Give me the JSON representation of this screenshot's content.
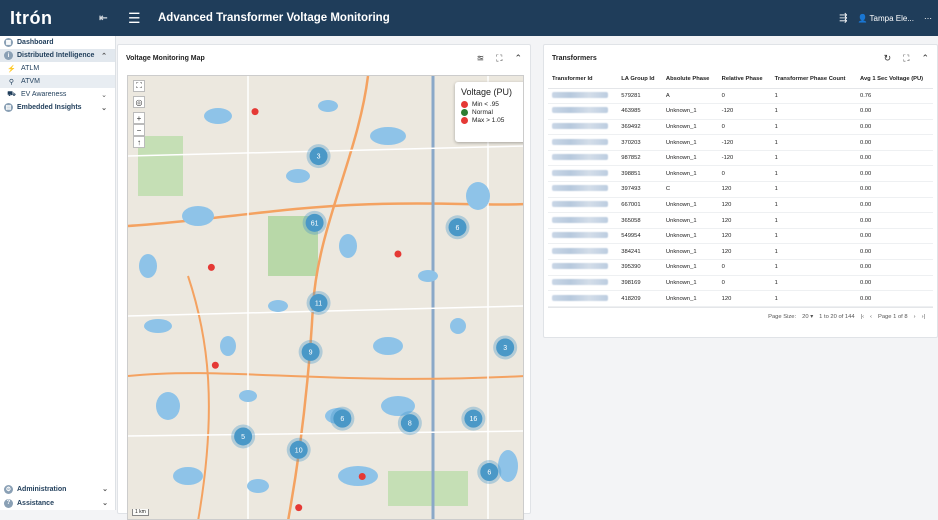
{
  "header": {
    "logo": "Itrón",
    "title": "Advanced Transformer Voltage Monitoring",
    "user": "Tampa Ele...",
    "collapse_icon": "sidebar-collapse-icon",
    "menu_icon": "hamburger-icon"
  },
  "sidebar": {
    "items": [
      {
        "label": "Dashboard",
        "icon": "dashboard-icon",
        "style": "bold"
      },
      {
        "label": "Distributed Intelligence",
        "icon": "info-icon",
        "style": "bold-active",
        "chevron": "^"
      },
      {
        "label": "ATLM",
        "icon": "bolt-icon",
        "style": "sub"
      },
      {
        "label": "ATVM",
        "icon": "pin-icon",
        "style": "sub-selected"
      },
      {
        "label": "EV Awareness",
        "icon": "car-icon",
        "style": "sub",
        "chevron": "v"
      },
      {
        "label": "Embedded Insights",
        "icon": "insights-icon",
        "style": "bold",
        "chevron": "v"
      }
    ],
    "bottom": [
      {
        "label": "Administration",
        "icon": "admin-icon",
        "chevron": "v"
      },
      {
        "label": "Assistance",
        "icon": "help-icon",
        "chevron": "v"
      }
    ]
  },
  "map_panel": {
    "title": "Voltage Monitoring Map",
    "legend": {
      "title": "Voltage (PU)",
      "items": [
        {
          "label": "Min < .95",
          "color": "#e53935"
        },
        {
          "label": "Normal",
          "color": "#2e7d32"
        },
        {
          "label": "Max > 1.05",
          "color": "#e53935"
        }
      ]
    },
    "clusters": [
      {
        "label": "3",
        "fx": 0.48,
        "fy": 0.18
      },
      {
        "label": "61",
        "fx": 0.47,
        "fy": 0.33
      },
      {
        "label": "6",
        "fx": 0.83,
        "fy": 0.34
      },
      {
        "label": "11",
        "fx": 0.48,
        "fy": 0.51
      },
      {
        "label": "9",
        "fx": 0.46,
        "fy": 0.62
      },
      {
        "label": "3",
        "fx": 0.95,
        "fy": 0.61
      },
      {
        "label": "6",
        "fx": 0.54,
        "fy": 0.77
      },
      {
        "label": "8",
        "fx": 0.71,
        "fy": 0.78
      },
      {
        "label": "16",
        "fx": 0.87,
        "fy": 0.77
      },
      {
        "label": "5",
        "fx": 0.29,
        "fy": 0.81
      },
      {
        "label": "10",
        "fx": 0.43,
        "fy": 0.84
      },
      {
        "label": "6",
        "fx": 0.91,
        "fy": 0.89
      }
    ],
    "markers": [
      {
        "fx": 0.32,
        "fy": 0.08
      },
      {
        "fx": 0.21,
        "fy": 0.43
      },
      {
        "fx": 0.68,
        "fy": 0.4
      },
      {
        "fx": 0.22,
        "fy": 0.65
      },
      {
        "fx": 0.59,
        "fy": 0.9
      },
      {
        "fx": 0.43,
        "fy": 0.97
      }
    ],
    "scale": "1 km"
  },
  "transformers": {
    "title": "Transformers",
    "columns": [
      "Transformer Id",
      "LA Group Id",
      "Absolute Phase",
      "Relative Phase",
      "Transformer Phase Count",
      "Avg 1 Sec Voltage (PU)"
    ],
    "rows": [
      [
        "579281",
        "A",
        "0",
        "1",
        "0.76"
      ],
      [
        "463985",
        "Unknown_1",
        "-120",
        "1",
        "0.00"
      ],
      [
        "369492",
        "Unknown_1",
        "0",
        "1",
        "0.00"
      ],
      [
        "370203",
        "Unknown_1",
        "-120",
        "1",
        "0.00"
      ],
      [
        "987852",
        "Unknown_1",
        "-120",
        "1",
        "0.00"
      ],
      [
        "398851",
        "Unknown_1",
        "0",
        "1",
        "0.00"
      ],
      [
        "397493",
        "C",
        "120",
        "1",
        "0.00"
      ],
      [
        "667001",
        "Unknown_1",
        "120",
        "1",
        "0.00"
      ],
      [
        "365058",
        "Unknown_1",
        "120",
        "1",
        "0.00"
      ],
      [
        "549954",
        "Unknown_1",
        "120",
        "1",
        "0.00"
      ],
      [
        "384241",
        "Unknown_1",
        "120",
        "1",
        "0.00"
      ],
      [
        "395390",
        "Unknown_1",
        "0",
        "1",
        "0.00"
      ],
      [
        "398169",
        "Unknown_1",
        "0",
        "1",
        "0.00"
      ],
      [
        "418209",
        "Unknown_1",
        "120",
        "1",
        "0.00"
      ]
    ],
    "pager": {
      "page_size_label": "Page Size:",
      "page_size": "20",
      "range": "1 to 20 of 144",
      "page": "Page 1 of 8"
    }
  }
}
